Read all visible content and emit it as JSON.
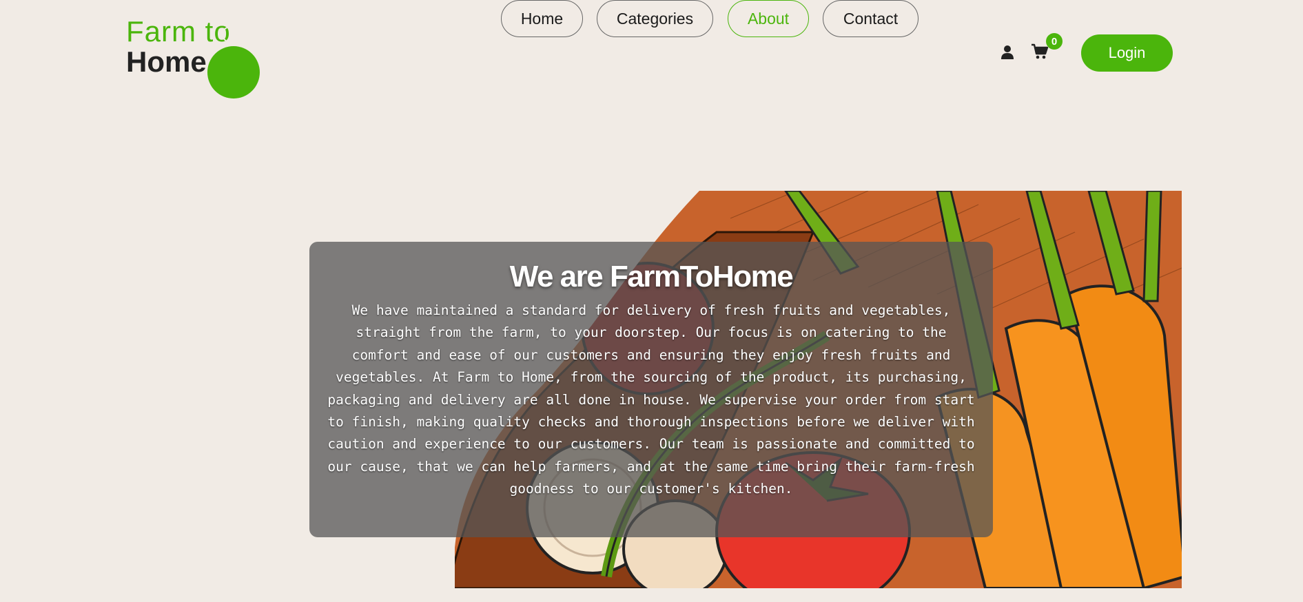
{
  "logo": {
    "line1": "Farm to",
    "line2": "Home"
  },
  "nav": {
    "items": [
      {
        "label": "Home",
        "active": false
      },
      {
        "label": "Categories",
        "active": false
      },
      {
        "label": "About",
        "active": true
      },
      {
        "label": "Contact",
        "active": false
      }
    ]
  },
  "header": {
    "user_icon": "user-icon",
    "cart_icon": "cart-icon",
    "cart_count": "0",
    "login_label": "Login"
  },
  "hero": {
    "title": "We are FarmToHome",
    "body": "We have maintained a standard for delivery of fresh fruits and vegetables, straight from the farm, to your doorstep. Our focus is on catering to the comfort and ease of our customers and ensuring they enjoy fresh fruits and vegetables. At Farm to Home, from the sourcing of the product, its purchasing, packaging and delivery are all done in house. We supervise your order from start to finish, making quality checks and thorough inspections before we deliver with caution and experience to our customers. Our team is passionate and committed to our cause, that we can help farmers, and at the same time bring their farm-fresh goodness to our customer's kitchen.",
    "image": "vegetables-illustration"
  },
  "colors": {
    "accent": "#4bb50c",
    "background": "#f1ebe5",
    "text": "#1a1a1a"
  }
}
